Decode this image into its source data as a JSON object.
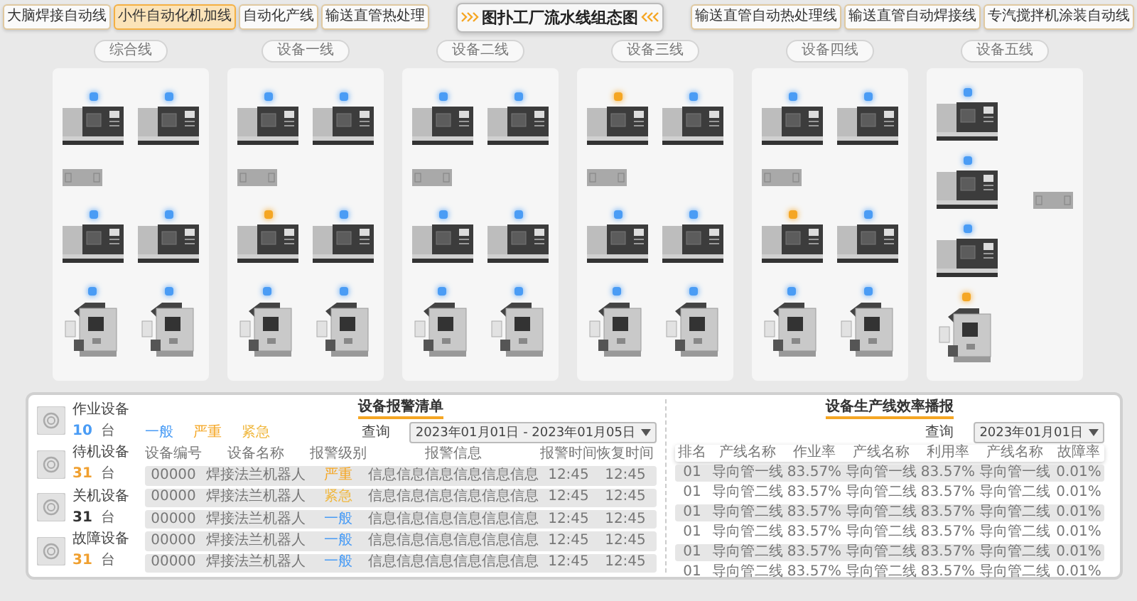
{
  "header": {
    "title": "图扑工厂流水线组态图",
    "left_tabs": [
      {
        "label": "大脑焊接自动线",
        "selected": false
      },
      {
        "label": "小件自动化机加线",
        "selected": true
      },
      {
        "label": "自动化产线",
        "selected": false
      },
      {
        "label": "输送直管热处理",
        "selected": false
      }
    ],
    "right_tabs": [
      {
        "label": "输送直管自动热处理线",
        "selected": false
      },
      {
        "label": "输送直管自动焊接线",
        "selected": false
      },
      {
        "label": "专汽搅拌机涂装自动线",
        "selected": false
      }
    ]
  },
  "lines": [
    {
      "label": "综合线",
      "rows": [
        [
          {
            "kind": "lathe",
            "color": "#4a9cf5"
          },
          {
            "kind": "lathe",
            "color": "#4a9cf5"
          }
        ],
        [
          {
            "kind": "conveyor"
          }
        ],
        [
          {
            "kind": "lathe",
            "color": "#4a9cf5"
          },
          {
            "kind": "lathe",
            "color": "#4a9cf5"
          }
        ],
        [
          {
            "kind": "robot",
            "color": "#4a9cf5"
          },
          {
            "kind": "robot",
            "color": "#4a9cf5"
          }
        ]
      ]
    },
    {
      "label": "设备一线",
      "rows": [
        [
          {
            "kind": "lathe",
            "color": "#4a9cf5"
          },
          {
            "kind": "lathe",
            "color": "#4a9cf5"
          }
        ],
        [
          {
            "kind": "conveyor"
          }
        ],
        [
          {
            "kind": "lathe",
            "color": "#f5a623"
          },
          {
            "kind": "lathe",
            "color": "#4a9cf5"
          }
        ],
        [
          {
            "kind": "robot",
            "color": "#4a9cf5"
          },
          {
            "kind": "robot",
            "color": "#4a9cf5"
          }
        ]
      ]
    },
    {
      "label": "设备二线",
      "rows": [
        [
          {
            "kind": "lathe",
            "color": "#4a9cf5"
          },
          {
            "kind": "lathe",
            "color": "#4a9cf5"
          }
        ],
        [
          {
            "kind": "conveyor"
          }
        ],
        [
          {
            "kind": "lathe",
            "color": "#4a9cf5"
          },
          {
            "kind": "lathe",
            "color": "#4a9cf5"
          }
        ],
        [
          {
            "kind": "robot",
            "color": "#4a9cf5"
          },
          {
            "kind": "robot",
            "color": "#4a9cf5"
          }
        ]
      ]
    },
    {
      "label": "设备三线",
      "rows": [
        [
          {
            "kind": "lathe",
            "color": "#f5a623"
          },
          {
            "kind": "lathe",
            "color": "#4a9cf5"
          }
        ],
        [
          {
            "kind": "conveyor"
          }
        ],
        [
          {
            "kind": "lathe",
            "color": "#4a9cf5"
          },
          {
            "kind": "lathe",
            "color": "#4a9cf5"
          }
        ],
        [
          {
            "kind": "robot",
            "color": "#4a9cf5"
          },
          {
            "kind": "robot",
            "color": "#4a9cf5"
          }
        ]
      ]
    },
    {
      "label": "设备四线",
      "rows": [
        [
          {
            "kind": "lathe",
            "color": "#4a9cf5"
          },
          {
            "kind": "lathe",
            "color": "#4a9cf5"
          }
        ],
        [
          {
            "kind": "conveyor"
          }
        ],
        [
          {
            "kind": "lathe",
            "color": "#f5a623"
          },
          {
            "kind": "lathe",
            "color": "#4a9cf5"
          }
        ],
        [
          {
            "kind": "robot",
            "color": "#4a9cf5"
          },
          {
            "kind": "robot",
            "color": "#4a9cf5"
          }
        ]
      ]
    },
    {
      "label": "设备五线",
      "rows": [
        [
          {
            "kind": "lathe",
            "color": "#4a9cf5"
          }
        ],
        [
          {
            "kind": "lathe",
            "color": "#4a9cf5"
          },
          {
            "kind": "conveyor"
          }
        ],
        [
          {
            "kind": "lathe",
            "color": "#4a9cf5"
          }
        ],
        [
          {
            "kind": "robot",
            "color": "#f5a623"
          }
        ]
      ]
    }
  ],
  "device_stats": [
    {
      "label": "作业设备",
      "count": "10",
      "unit": "台",
      "color": "#4a9cf5"
    },
    {
      "label": "待机设备",
      "count": "31",
      "unit": "台",
      "color": "#f0a030"
    },
    {
      "label": "关机设备",
      "count": "31",
      "unit": "台",
      "color": "#333333"
    },
    {
      "label": "故障设备",
      "count": "31",
      "unit": "台",
      "color": "#f0a030"
    }
  ],
  "alarm_panel": {
    "title": "设备报警清单",
    "legend": [
      {
        "label": "一般",
        "color": "#4a9cf5"
      },
      {
        "label": "严重",
        "color": "#f5a623"
      },
      {
        "label": "紧急",
        "color": "#f0b840"
      }
    ],
    "query_label": "查询",
    "date_range": "2023年01月01日 - 2023年01月05日",
    "columns": [
      "设备编号",
      "设备名称",
      "报警级别",
      "报警信息",
      "报警时间",
      "恢复时间"
    ],
    "rows": [
      {
        "code": "00000",
        "name": "焊接法兰机器人",
        "severity": "严重",
        "color": "#f5a623",
        "info": "信息信息信息信息信息信息",
        "alarm_time": "12:45",
        "recover_time": "12:45"
      },
      {
        "code": "00000",
        "name": "焊接法兰机器人",
        "severity": "紧急",
        "color": "#f0b840",
        "info": "信息信息信息信息信息信息",
        "alarm_time": "12:45",
        "recover_time": "12:45"
      },
      {
        "code": "00000",
        "name": "焊接法兰机器人",
        "severity": "一般",
        "color": "#4a9cf5",
        "info": "信息信息信息信息信息信息",
        "alarm_time": "12:45",
        "recover_time": "12:45"
      },
      {
        "code": "00000",
        "name": "焊接法兰机器人",
        "severity": "一般",
        "color": "#4a9cf5",
        "info": "信息信息信息信息信息信息",
        "alarm_time": "12:45",
        "recover_time": "12:45"
      },
      {
        "code": "00000",
        "name": "焊接法兰机器人",
        "severity": "一般",
        "color": "#4a9cf5",
        "info": "信息信息信息信息信息信息",
        "alarm_time": "12:45",
        "recover_time": "12:45"
      }
    ]
  },
  "efficiency_panel": {
    "title": "设备生产线效率播报",
    "query_label": "查询",
    "date": "2023年01月01日",
    "columns": [
      "排名",
      "产线名称",
      "作业率",
      "产线名称",
      "利用率",
      "产线名称",
      "故障率"
    ],
    "rows": [
      [
        "01",
        "导向管一线",
        "83.57%",
        "导向管一线",
        "83.57%",
        "导向管一线",
        "0.01%"
      ],
      [
        "01",
        "导向管二线",
        "83.57%",
        "导向管二线",
        "83.57%",
        "导向管二线",
        "0.01%"
      ],
      [
        "01",
        "导向管二线",
        "83.57%",
        "导向管二线",
        "83.57%",
        "导向管二线",
        "0.01%"
      ],
      [
        "01",
        "导向管二线",
        "83.57%",
        "导向管二线",
        "83.57%",
        "导向管二线",
        "0.01%"
      ],
      [
        "01",
        "导向管二线",
        "83.57%",
        "导向管二线",
        "83.57%",
        "导向管二线",
        "0.01%"
      ],
      [
        "01",
        "导向管二线",
        "83.57%",
        "导向管二线",
        "83.57%",
        "导向管二线",
        "0.01%"
      ]
    ]
  }
}
